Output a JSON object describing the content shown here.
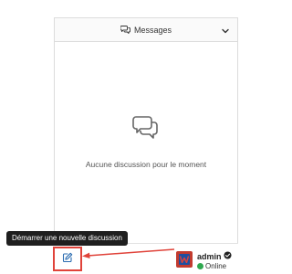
{
  "panel": {
    "title": "Messages",
    "title_icon": "chat-bubbles-icon",
    "collapse_icon": "chevron-down-icon",
    "empty_icon": "chat-bubbles-icon",
    "empty_text": "Aucune discussion pour le moment"
  },
  "footer": {
    "new_discussion_icon": "edit-pencil-icon",
    "tooltip": "Démarrer une nouvelle discussion",
    "user": {
      "name": "admin",
      "verified_icon": "verified-check-icon",
      "status": "Online",
      "status_color": "#2fa84f"
    }
  },
  "colors": {
    "highlight": "#e0433a",
    "tooltip_bg": "#1f1f1f"
  }
}
